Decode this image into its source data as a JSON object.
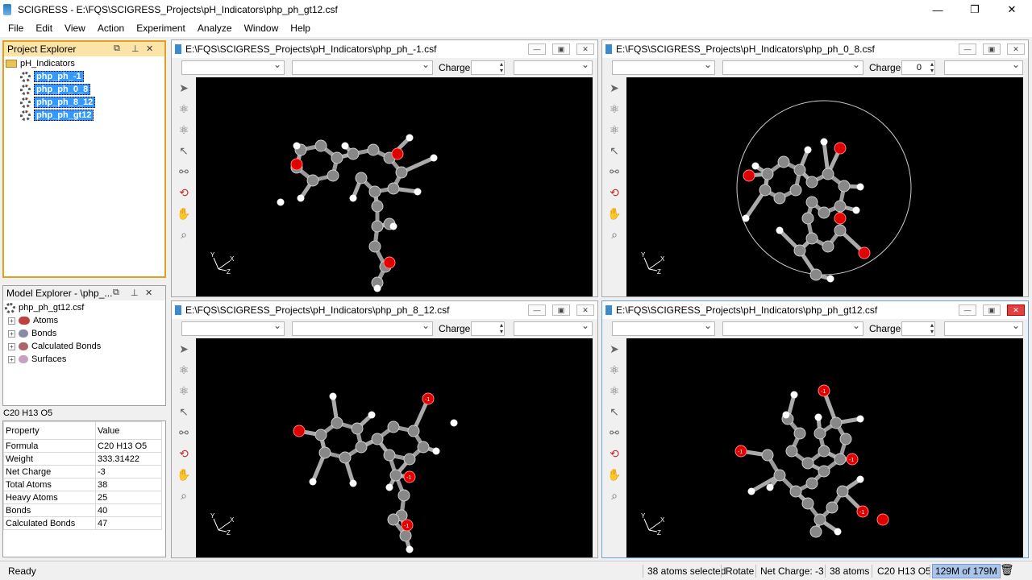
{
  "window": {
    "title": "SCIGRESS - E:\\FQS\\SCIGRESS_Projects\\pH_Indicators\\php_ph_gt12.csf"
  },
  "menu": [
    "File",
    "Edit",
    "View",
    "Action",
    "Experiment",
    "Analyze",
    "Window",
    "Help"
  ],
  "project_explorer": {
    "title": "Project Explorer",
    "root": "pH_Indicators",
    "items": [
      "php_ph_-1",
      "php_ph_0_8",
      "php_ph_8_12",
      "php_ph_gt12"
    ]
  },
  "model_explorer": {
    "title": "Model Explorer - \\php_...",
    "root": "php_ph_gt12.csf",
    "items": [
      "Atoms",
      "Bonds",
      "Calculated Bonds",
      "Surfaces"
    ]
  },
  "properties": {
    "formula_header": "C20 H13 O5",
    "col_property": "Property",
    "col_value": "Value",
    "rows": [
      {
        "p": "Formula",
        "v": "C20 H13 O5"
      },
      {
        "p": "Weight",
        "v": "333.31422"
      },
      {
        "p": "Net Charge",
        "v": "-3"
      },
      {
        "p": "Total Atoms",
        "v": "38"
      },
      {
        "p": "Heavy Atoms",
        "v": "25"
      },
      {
        "p": "Bonds",
        "v": "40"
      },
      {
        "p": "Calculated Bonds",
        "v": "47"
      }
    ]
  },
  "docs": [
    {
      "title": "E:\\FQS\\SCIGRESS_Projects\\pH_Indicators\\php_ph_-1.csf",
      "charge_label": "Charge:",
      "charge_value": ""
    },
    {
      "title": "E:\\FQS\\SCIGRESS_Projects\\pH_Indicators\\php_ph_0_8.csf",
      "charge_label": "Charge:",
      "charge_value": "0"
    },
    {
      "title": "E:\\FQS\\SCIGRESS_Projects\\pH_Indicators\\php_ph_8_12.csf",
      "charge_label": "Charge:",
      "charge_value": ""
    },
    {
      "title": "E:\\FQS\\SCIGRESS_Projects\\pH_Indicators\\php_ph_gt12.csf",
      "charge_label": "Charge:",
      "charge_value": ""
    }
  ],
  "axis_labels": {
    "y": "Y",
    "x": "X",
    "z": "Z"
  },
  "atom_labels": {
    "minus": "-1"
  },
  "status": {
    "ready": "Ready",
    "selected": "38 atoms selected",
    "mode": "Rotate",
    "net_charge": "Net Charge: -3",
    "atoms": "38 atoms",
    "formula": "C20 H13 O5",
    "memory": "129M of 179M"
  },
  "colors": {
    "selection": "#3399ff",
    "panel_header": "#fbe4a8",
    "carbon": "#888888",
    "oxygen": "#e00000",
    "hydrogen": "#ffffff"
  }
}
